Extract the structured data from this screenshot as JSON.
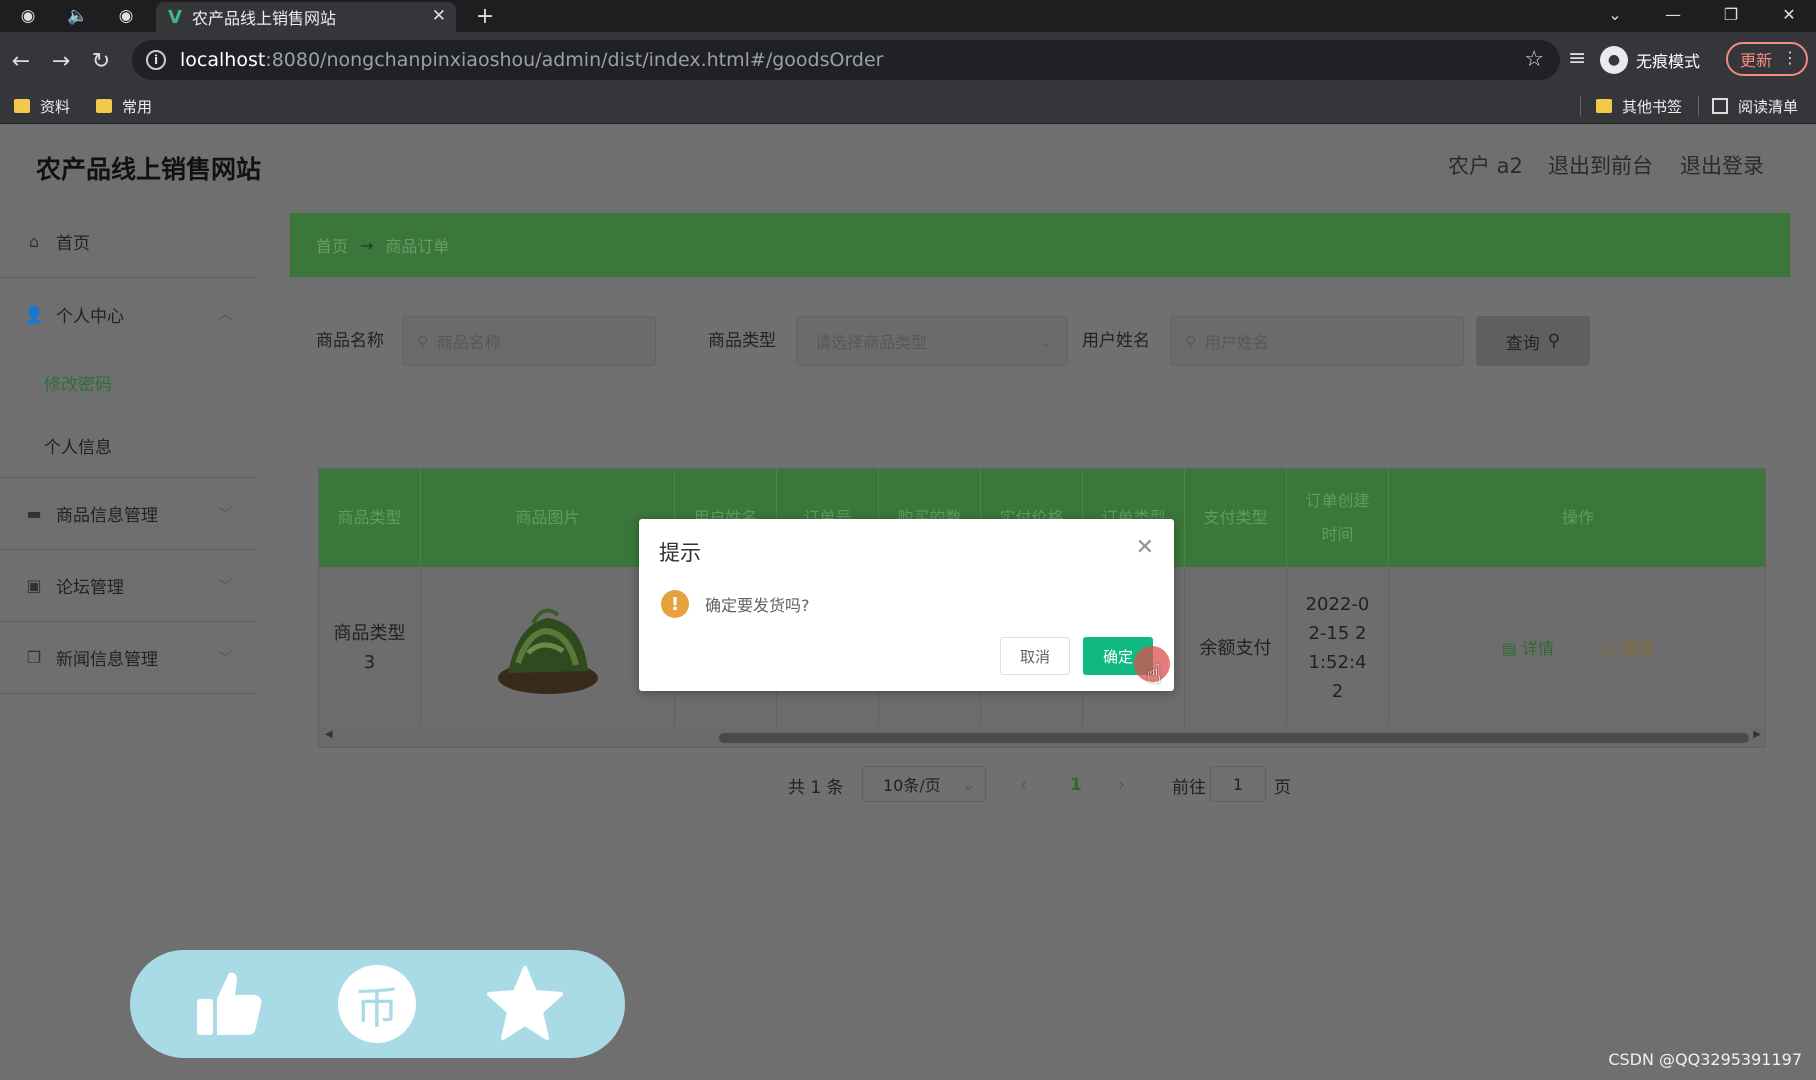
{
  "browser": {
    "tab_title": "农产品线上销售网站",
    "url_host": "localhost",
    "url_path": ":8080/nongchanpinxiaoshou/admin/dist/index.html#/goodsOrder",
    "incognito_label": "无痕模式",
    "update_label": "更新",
    "bookmarks": [
      "资料",
      "常用"
    ],
    "other_bookmarks": "其他书签",
    "reading_list": "阅读清单"
  },
  "header": {
    "site_title": "农产品线上销售网站",
    "user": "农户 a2",
    "back_front": "退出到前台",
    "logout": "退出登录"
  },
  "sidebar": {
    "home": "首页",
    "personal": "个人中心",
    "change_password": "修改密码",
    "profile": "个人信息",
    "goods_mgmt": "商品信息管理",
    "forum_mgmt": "论坛管理",
    "news_mgmt": "新闻信息管理"
  },
  "breadcrumb": {
    "home": "首页",
    "arrow": "→",
    "current": "商品订单"
  },
  "search": {
    "name_label": "商品名称",
    "name_placeholder": "商品名称",
    "type_label": "商品类型",
    "type_placeholder": "请选择商品类型",
    "user_label": "用户姓名",
    "user_placeholder": "用户姓名",
    "query_button": "查询"
  },
  "table": {
    "columns": [
      "商品类型",
      "商品图片",
      "用户姓名",
      "订单号",
      "购买的数",
      "实付价格",
      "订单类型",
      "支付类型",
      "订单创建时间",
      "操作"
    ],
    "row": {
      "goods_type": "商品类型3",
      "pay_type": "余额支付",
      "created": "2022-02-15 21:52:42",
      "action_detail": "详情",
      "action_ship": "发货"
    }
  },
  "pagination": {
    "total": "共 1 条",
    "page_size": "10条/页",
    "current_page": "1",
    "goto_label": "前往",
    "goto_value": "1",
    "page_suffix": "页"
  },
  "dialog": {
    "title": "提示",
    "message": "确定要发货吗?",
    "cancel": "取消",
    "confirm": "确定"
  },
  "watermark": "CSDN @QQ3295391197",
  "colors": {
    "accent_green": "#3b763a",
    "confirm_button": "#10b981",
    "warning": "#e6a23c",
    "float_bar": "#a9dbe6"
  }
}
